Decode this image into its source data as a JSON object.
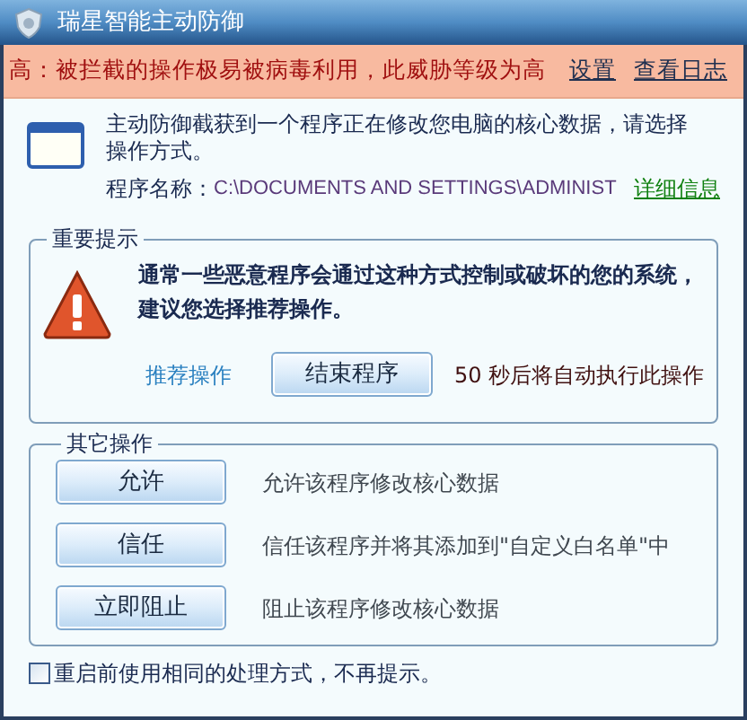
{
  "window": {
    "title": "瑞星智能主动防御"
  },
  "alert": {
    "text": "高：被拦截的操作极易被病毒利用，此威胁等级为高",
    "links": [
      "设置",
      "查看日志"
    ]
  },
  "notice": {
    "message": "主动防御截获到一个程序正在修改您电脑的核心数据，请选择操作方式。",
    "program_label": "程序名称：",
    "program_path": "C:\\DOCUMENTS AND SETTINGS\\ADMINIST",
    "details_link": "详细信息"
  },
  "important": {
    "title": "重要提示",
    "warning": "通常一些恶意程序会通过这种方式控制或破坏的您的系统，建议您选择推荐操作。",
    "recommend_label": "推荐操作",
    "recommend_button": "结束程序",
    "countdown_number": "50",
    "countdown_text": "秒后将自动执行此操作"
  },
  "other": {
    "title": "其它操作",
    "actions": [
      {
        "button": "允许",
        "description": "允许该程序修改核心数据"
      },
      {
        "button": "信任",
        "description": "信任该程序并将其添加到\"自定义白名单\"中"
      },
      {
        "button": "立即阻止",
        "description": "阻止该程序修改核心数据"
      }
    ]
  },
  "remember": {
    "label": "重启前使用相同的处理方式，不再提示。",
    "checked": false
  }
}
